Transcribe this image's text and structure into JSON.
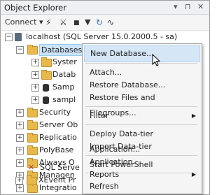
{
  "titlebar": {
    "title": "Object Explorer",
    "pin": "▾ ⊓ ✕"
  },
  "toolbar": {
    "connect": "Connect ▾",
    "icons": [
      "connect-icon",
      "disconnect-icon",
      "stop-icon",
      "filter-icon",
      "refresh-icon",
      "activity-icon"
    ]
  },
  "tree": {
    "server": "localhost (SQL Server 15.0.2000.5 - sa)",
    "databases": "Databases",
    "db_children": [
      "Syster",
      "Datab",
      "Samp",
      "sampl"
    ],
    "items": [
      "Security",
      "Server Ob",
      "Replicatio",
      "PolyBase",
      "Always O",
      "Managen",
      "Integratio",
      "SQL Serve",
      "XEvent Pr"
    ]
  },
  "context_menu": {
    "items": [
      "New Database...",
      "Attach...",
      "Restore Database...",
      "Restore Files and Filegroups...",
      "Filter",
      "Deploy Data-tier Application...",
      "Import Data-tier Application...",
      "Start PowerShell",
      "Reports",
      "Refresh"
    ]
  }
}
